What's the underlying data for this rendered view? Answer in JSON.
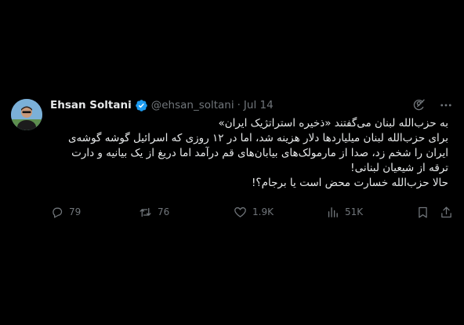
{
  "tweet": {
    "author": {
      "display_name": "Ehsan Soltani",
      "handle": "@ehsan_soltani",
      "verified": true,
      "avatar": "avatar-photo"
    },
    "separator": "·",
    "date": "Jul 14",
    "top_icons": [
      "grok-icon",
      "more-icon"
    ],
    "body_lines": [
      "به حزب‌الله لبنان می‌گفتند «ذخیره استراتژیک ایران»",
      "برای حزب‌الله لبنان میلیاردها دلار هزینه شد، اما در ۱۲ روزی که اسرائیل گوشه گوشه‌ی ایران را شخم زد، صدا از مارمولک‌های بیابان‌های قم درآمد اما دریغ از یک بیانیه و دارت ترقه از شیعیان لبنانی!",
      "حالا حزب‌الله خسارت محض است یا برجام؟!"
    ],
    "stats": {
      "replies": "79",
      "reposts": "76",
      "likes": "1.9K",
      "views": "51K"
    },
    "colors": {
      "background": "#000000",
      "text": "#e7e9ea",
      "muted": "#71767b",
      "verified": "#1d9bf0"
    }
  }
}
